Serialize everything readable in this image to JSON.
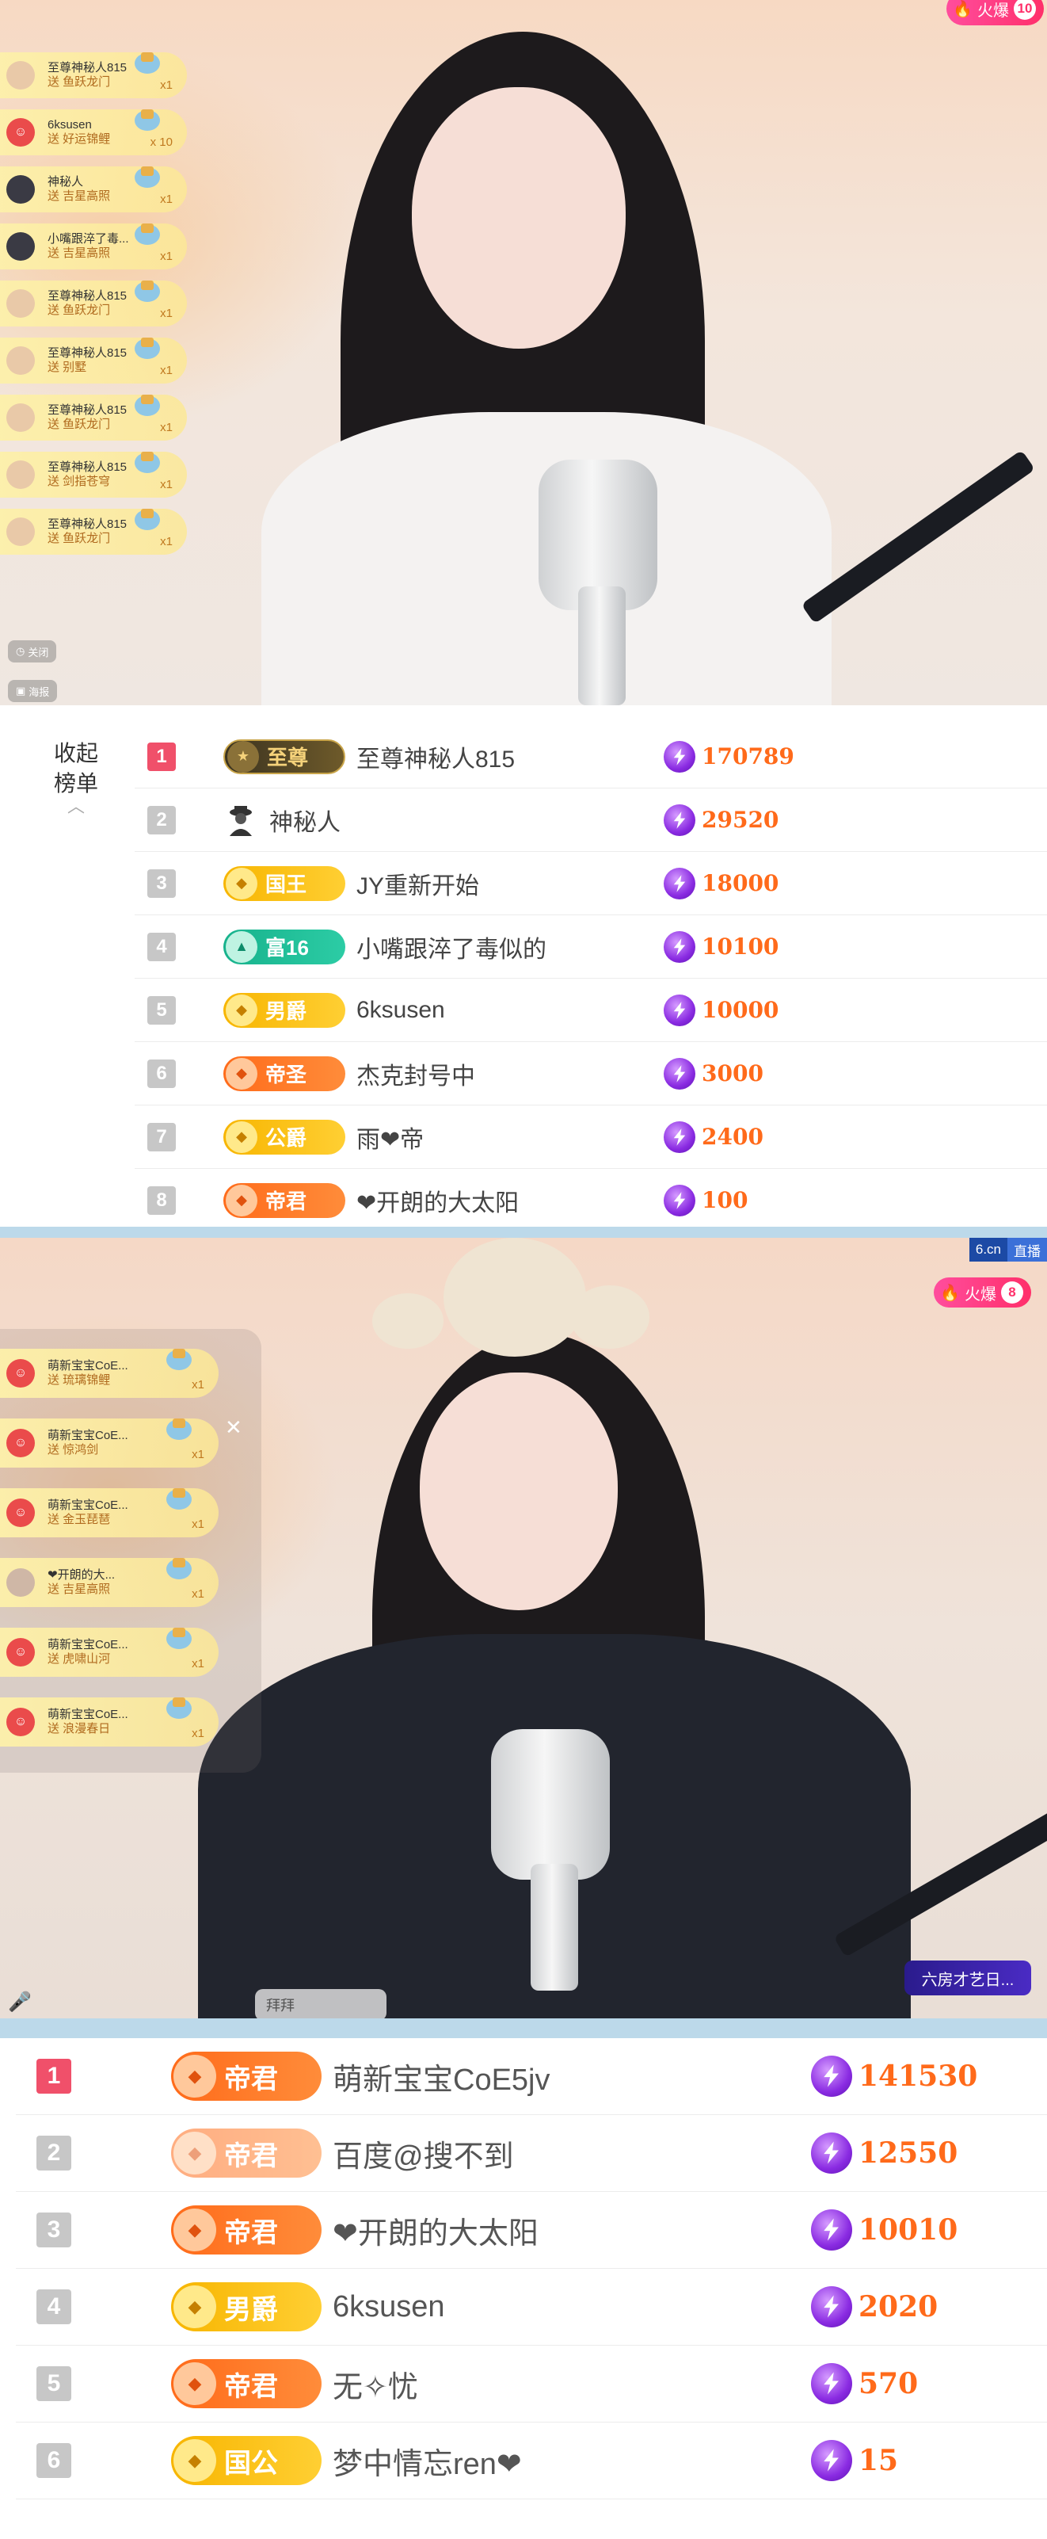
{
  "stream1": {
    "hot_label": "火爆",
    "hot_count": "10",
    "gifts": [
      {
        "user": "至尊神秘人815",
        "text": "送 鱼跃龙门",
        "count": "x1"
      },
      {
        "user": "6ksusen",
        "text": "送 好运锦鲤",
        "count": "x 10"
      },
      {
        "user": "神秘人",
        "text": "送 吉星高照",
        "count": "x1"
      },
      {
        "user": "小嘴跟淬了毒...",
        "text": "送 吉星高照",
        "count": "x1"
      },
      {
        "user": "至尊神秘人815",
        "text": "送 鱼跃龙门",
        "count": "x1"
      },
      {
        "user": "至尊神秘人815",
        "text": "送 别墅",
        "count": "x1"
      },
      {
        "user": "至尊神秘人815",
        "text": "送 鱼跃龙门",
        "count": "x1"
      },
      {
        "user": "至尊神秘人815",
        "text": "送 剑指苍穹",
        "count": "x1"
      },
      {
        "user": "至尊神秘人815",
        "text": "送 鱼跃龙门",
        "count": "x1"
      }
    ],
    "controls": {
      "close": "关闭",
      "bottom": "海报"
    }
  },
  "board1": {
    "collapse_label": "收起榜单",
    "chevron_icon": "chevron-up-icon",
    "rows": [
      {
        "rank": "1",
        "title": "至尊",
        "style": "dark",
        "name": "至尊神秘人815",
        "score": "170789"
      },
      {
        "rank": "2",
        "title": "",
        "style": "person",
        "name": "神秘人",
        "score": "29520"
      },
      {
        "rank": "3",
        "title": "国王",
        "style": "gold",
        "name": "JY重新开始",
        "score": "18000"
      },
      {
        "rank": "4",
        "title": "富16",
        "style": "teal",
        "name": "小嘴跟淬了毒似的",
        "score": "10100"
      },
      {
        "rank": "5",
        "title": "男爵",
        "style": "gold",
        "name": "6ksusen",
        "score": "10000"
      },
      {
        "rank": "6",
        "title": "帝圣",
        "style": "orange",
        "name": "杰克封号中",
        "score": "3000"
      },
      {
        "rank": "7",
        "title": "公爵",
        "style": "gold",
        "name": "雨❤帝",
        "score": "2400"
      },
      {
        "rank": "8",
        "title": "帝君",
        "style": "orange",
        "name": "❤开朗的大太阳",
        "score": "100"
      }
    ]
  },
  "stream2": {
    "site": "6.cn",
    "live_label": "直播",
    "hot_label": "火爆",
    "hot_count": "8",
    "close_icon": "close-icon",
    "gifts": [
      {
        "user": "萌新宝宝CoE...",
        "text": "送 琉璃锦鲤",
        "count": "x1"
      },
      {
        "user": "萌新宝宝CoE...",
        "text": "送 惊鸿剑",
        "count": "x1"
      },
      {
        "user": "萌新宝宝CoE...",
        "text": "送 金玉琵琶",
        "count": "x1"
      },
      {
        "user": "❤开朗的大...",
        "text": "送 吉星高照",
        "count": "x1"
      },
      {
        "user": "萌新宝宝CoE...",
        "text": "送 虎啸山河",
        "count": "x1"
      },
      {
        "user": "萌新宝宝CoE...",
        "text": "送 浪漫春日",
        "count": "x1"
      }
    ],
    "chat_message": "拜拜",
    "room_tag": "六房才艺日..."
  },
  "board2": {
    "rows": [
      {
        "rank": "1",
        "title": "帝君",
        "style": "orange",
        "name": "萌新宝宝CoE5jv",
        "score": "141530"
      },
      {
        "rank": "2",
        "title": "帝君",
        "style": "orange-faded",
        "name": "百度@搜不到",
        "score": "12550"
      },
      {
        "rank": "3",
        "title": "帝君",
        "style": "orange",
        "name": "❤开朗的大太阳",
        "score": "10010"
      },
      {
        "rank": "4",
        "title": "男爵",
        "style": "gold",
        "name": "6ksusen",
        "score": "2020"
      },
      {
        "rank": "5",
        "title": "帝君",
        "style": "orange",
        "name": "无✧忧",
        "score": "570"
      },
      {
        "rank": "6",
        "title": "国公",
        "style": "gold",
        "name": "梦中情忘ren❤",
        "score": "15"
      }
    ]
  },
  "colors": {
    "rank_first": "#f0506a",
    "rank_other": "#c7c7c7",
    "score": "#ff6a1a",
    "hot_badge": "#ff2f6a",
    "divider": "#bcd9ea"
  }
}
